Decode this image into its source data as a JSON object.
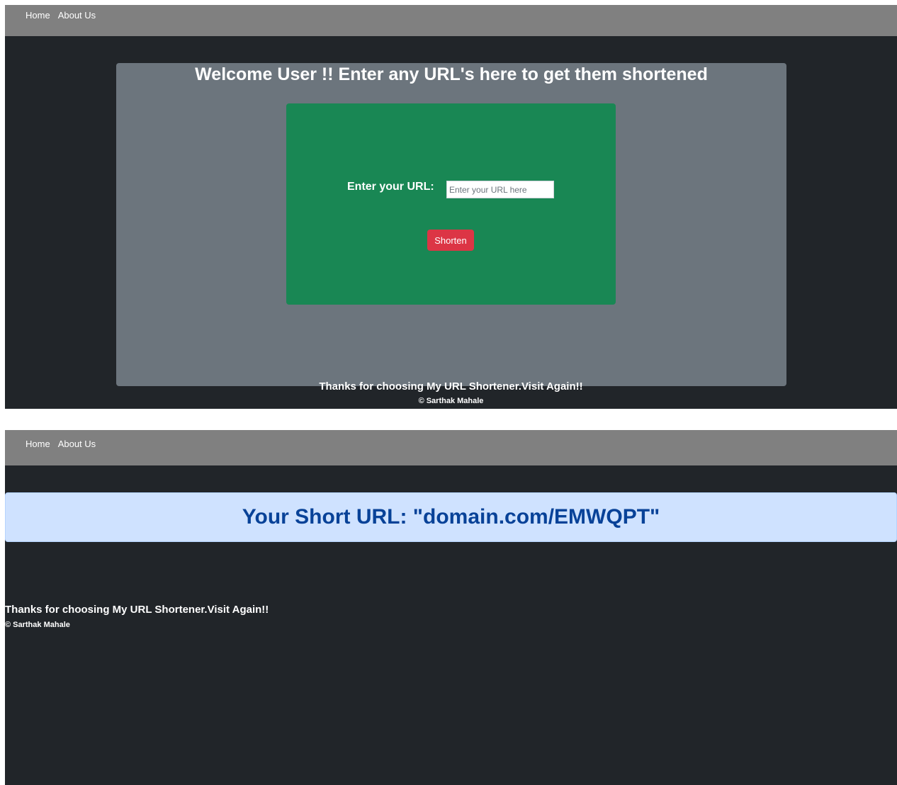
{
  "nav": {
    "home_label": "Home",
    "about_label": "About Us"
  },
  "main": {
    "welcome_title": "Welcome User !! Enter any URL's here to get them shortened",
    "url_label": "Enter your URL:",
    "url_placeholder": "Enter your URL here",
    "url_value": "",
    "shorten_label": "Shorten"
  },
  "result": {
    "short_url_text": "Your Short URL: \"domain.com/EMWQPT\""
  },
  "footer": {
    "thanks_text": "Thanks for choosing My URL Shortener.Visit Again!!",
    "copyright_text": "© Sarthak Mahale"
  },
  "colors": {
    "page_bg": "#212529",
    "navbar_bg": "#808080",
    "panel_bg": "#6c757d",
    "form_bg": "#198754",
    "button_bg": "#dc3545",
    "alert_bg": "#cfe2ff",
    "alert_text": "#084298"
  }
}
